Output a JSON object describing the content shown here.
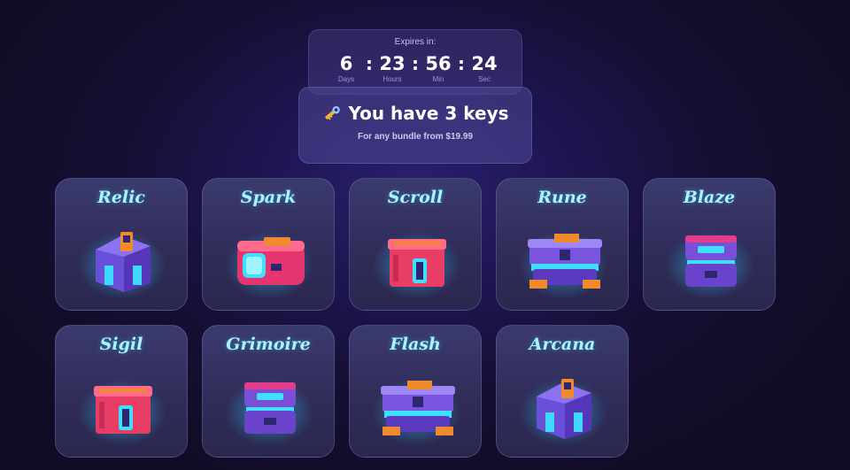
{
  "timer": {
    "label": "Expires in:",
    "units": [
      {
        "value": "6",
        "caption": "Days"
      },
      {
        "value": "23",
        "caption": "Hours"
      },
      {
        "value": "56",
        "caption": "Min"
      },
      {
        "value": "24",
        "caption": "Sec"
      }
    ],
    "separator": ":"
  },
  "keys": {
    "icon": "key-icon",
    "title": "You have 3 keys",
    "subtitle": "For any bundle from $19.99"
  },
  "chests": [
    {
      "name": "Relic",
      "style": "house",
      "body": "#6a4fd8",
      "accent": "#f08a2c"
    },
    {
      "name": "Spark",
      "style": "flat",
      "body": "#e4356e",
      "accent": "#f08a2c"
    },
    {
      "name": "Scroll",
      "style": "box",
      "body": "#e83e66",
      "accent": "#f08a2c"
    },
    {
      "name": "Rune",
      "style": "wide",
      "body": "#7a56e0",
      "accent": "#f08a2c"
    },
    {
      "name": "Blaze",
      "style": "stack",
      "body": "#7a4fd8",
      "accent": "#e23c8a"
    },
    {
      "name": "Sigil",
      "style": "box",
      "body": "#e83e66",
      "accent": "#f08a2c"
    },
    {
      "name": "Grimoire",
      "style": "stack",
      "body": "#7a4fd8",
      "accent": "#e23c8a"
    },
    {
      "name": "Flash",
      "style": "wide",
      "body": "#7a56e0",
      "accent": "#f08a2c"
    },
    {
      "name": "Arcana",
      "style": "house",
      "body": "#6a4fd8",
      "accent": "#f08a2c"
    }
  ],
  "colors": {
    "chest_name": "#a6f4ff",
    "glow": "#2ad4ff",
    "card_bg": "#34325f"
  }
}
